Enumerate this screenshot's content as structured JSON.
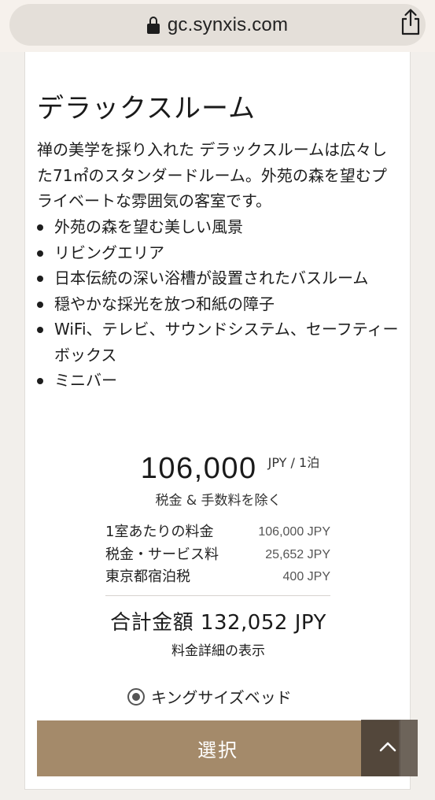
{
  "browser": {
    "url": "gc.synxis.com",
    "lock_icon": "lock-icon",
    "share_icon": "share-icon"
  },
  "room": {
    "title": "デラックスルーム",
    "description": "禅の美学を採り入れた デラックスルームは広々した71㎡のスタンダードルーム。外苑の森を望むプライベートな雰囲気の客室です。",
    "features": [
      "外苑の森を望む美しい風景",
      "リビングエリア",
      "日本伝統の深い浴槽が設置されたバスルーム",
      "穏やかな採光を放つ和紙の障子",
      "WiFi、テレビ、サウンドシステム、セーフティーボックス",
      "ミニバー"
    ]
  },
  "price": {
    "amount": "106,000",
    "unit": "JPY / 1泊",
    "note": "税金 & 手数料を除く",
    "breakdown": [
      {
        "label": "1室あたりの料金",
        "value": "106,000 JPY"
      },
      {
        "label": "税金・サービス料",
        "value": "25,652 JPY"
      },
      {
        "label": "東京都宿泊税",
        "value": "400 JPY"
      }
    ],
    "total_label": "合計金額",
    "total_value": "132,052 JPY",
    "detail_link": "料金詳細の表示"
  },
  "bed": {
    "label": "キングサイズベッド",
    "selected": true
  },
  "actions": {
    "select_label": "選択"
  },
  "colors": {
    "accent": "#a48a6a",
    "background": "#f2efeb",
    "card": "#ffffff"
  }
}
